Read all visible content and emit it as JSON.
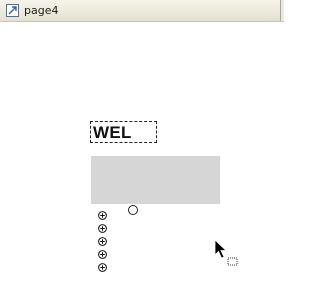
{
  "window": {
    "title": "page4",
    "icon": "page-icon"
  },
  "canvas": {
    "text_box": {
      "text": "WEL"
    },
    "gray_rectangle": {
      "color": "#d6d6d6"
    },
    "circle_handle": {
      "icon": "circle-icon"
    },
    "plus_items": [
      {
        "icon": "plus-circle-icon"
      },
      {
        "icon": "plus-circle-icon"
      },
      {
        "icon": "plus-circle-icon"
      },
      {
        "icon": "plus-circle-icon"
      },
      {
        "icon": "plus-circle-icon"
      }
    ],
    "cursor": {
      "icon": "drag-copy-cursor-icon"
    }
  }
}
